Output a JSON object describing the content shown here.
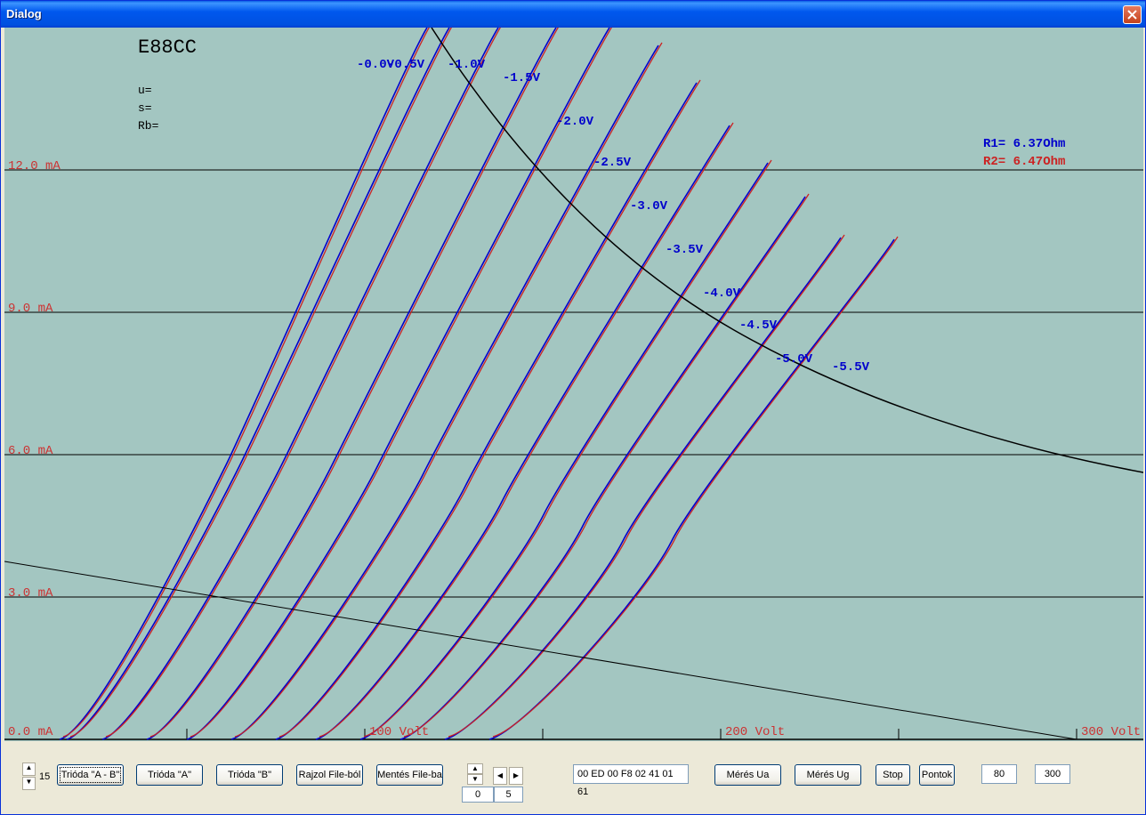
{
  "window": {
    "title": "Dialog"
  },
  "plot": {
    "tube_name": "E88CC",
    "params": [
      "u=",
      "s=",
      "Rb="
    ],
    "r1_label": "R1= 6.37Ohm",
    "r2_label": "R2= 6.47Ohm",
    "y_labels": [
      "12.0 mA",
      "9.0 mA",
      "6.0 mA",
      "3.0 mA",
      "0.0 mA"
    ],
    "x_labels": [
      "100 Volt",
      "200 Volt",
      "300 Volt"
    ],
    "grid_labels": [
      "-0.0V",
      "-0.5V",
      "-1.0V",
      "-1.5V",
      "-2.0V",
      "-2.5V",
      "-3.0V",
      "-3.5V",
      "-4.0V",
      "-4.5V",
      "-5.0V",
      "-5.5V"
    ],
    "colors": {
      "background": "#a3c6c1",
      "series_a": "#0000cc",
      "series_b": "#cc2222",
      "axis_label": "#cc3333",
      "grid": "#000000"
    }
  },
  "controls": {
    "count_value": "15",
    "buttons": {
      "trioda_ab": "Trióda \"A - B\"",
      "trioda_a": "Trióda  \"A\"",
      "trioda_b": "Trióda  \"B\"",
      "rajzol": "Rajzol File-ból",
      "mentes": "Mentés File-ba",
      "meres_ua": "Mérés Ua",
      "meres_ug": "Mérés Ug",
      "stop": "Stop",
      "pontok": "Pontok"
    },
    "hex_field": "00 ED 00 F8 02 41 01 61",
    "field_left": "0",
    "field_right": "5",
    "field_80": "80",
    "field_300": "300"
  }
}
